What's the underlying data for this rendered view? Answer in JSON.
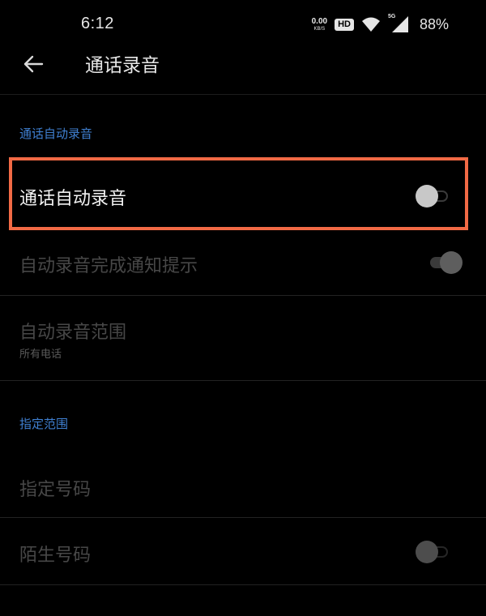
{
  "status_bar": {
    "time": "6:12",
    "net_speed_value": "0.00",
    "net_speed_unit": "KB/S",
    "hd_badge": "HD",
    "network_type": "5G",
    "battery": "88%",
    "icons": [
      "wifi-icon",
      "signal-icon"
    ]
  },
  "app_bar": {
    "title": "通话录音",
    "back_icon": "arrow-left-icon"
  },
  "sections": {
    "auto_record": {
      "header": "通话自动录音",
      "items": {
        "auto_record_switch": {
          "label": "通话自动录音",
          "enabled": true,
          "switch_on": false
        },
        "completion_notify": {
          "label": "自动录音完成通知提示",
          "enabled": false,
          "switch_on": true
        },
        "record_range": {
          "label": "自动录音范围",
          "subtitle": "所有电话",
          "enabled": false
        }
      }
    },
    "specified_range": {
      "header": "指定范围",
      "items": {
        "specified_numbers": {
          "label": "指定号码",
          "enabled": false
        },
        "unknown_numbers": {
          "label": "陌生号码",
          "enabled": false,
          "switch_on": false
        }
      }
    }
  },
  "colors": {
    "background": "#000000",
    "section_header": "#3f7fd0",
    "highlight": "#f26a45",
    "text_enabled": "#f2f2f2",
    "text_disabled": "#474747"
  }
}
